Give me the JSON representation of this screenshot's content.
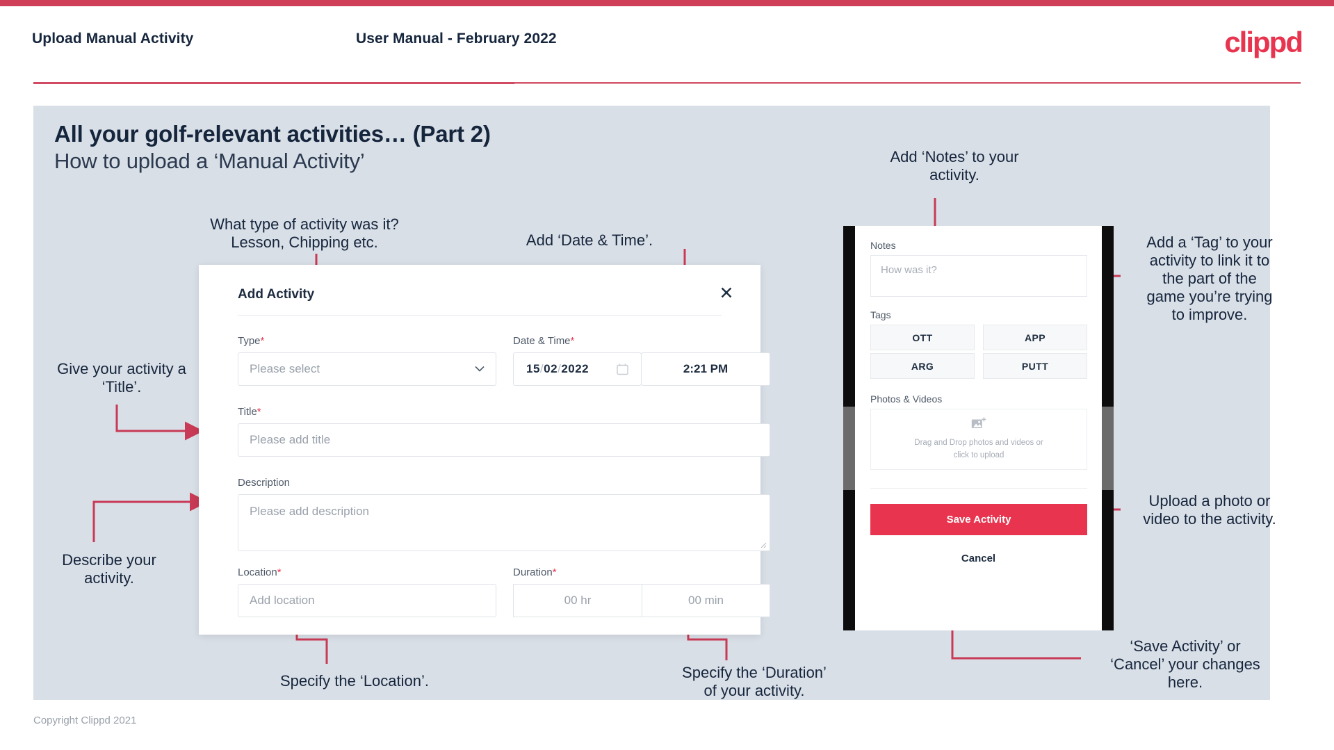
{
  "theme": {
    "brand_red": "#e8344e",
    "bar_red": "#cf4058",
    "arrow_red": "#c83a55",
    "slide_bg": "#d9dfe7",
    "ink": "#15253c"
  },
  "header": {
    "left_title": "Upload Manual Activity",
    "center_title": "User Manual - February 2022",
    "logo_text": "clippd"
  },
  "slide": {
    "title": "All your golf-relevant activities… (Part 2)",
    "subtitle": "How to upload a ‘Manual Activity’"
  },
  "annotations": {
    "type": "What type of activity was it?\nLesson, Chipping etc.",
    "type_line1": "What type of activity was it?",
    "type_line2": "Lesson, Chipping etc.",
    "datetime": "Add ‘Date & Time’.",
    "title": "Give your activity a\n‘Title’.",
    "title_line1": "Give your activity a",
    "title_line2": "‘Title’.",
    "description_line1": "Describe your",
    "description_line2": "activity.",
    "location": "Specify the ‘Location’.",
    "duration_line1": "Specify the ‘Duration’",
    "duration_line2": "of your activity.",
    "notes_line1": "Add ‘Notes’ to your",
    "notes_line2": "activity.",
    "tags_line1": "Add a ‘Tag’ to your",
    "tags_line2": "activity to link it to",
    "tags_line3": "the part of the",
    "tags_line4": "game you’re trying",
    "tags_line5": "to improve.",
    "upload_line1": "Upload a photo or",
    "upload_line2": "video to the activity.",
    "save_line1": "‘Save Activity’ or",
    "save_line2": "‘Cancel’ your changes",
    "save_line3": "here."
  },
  "dialog": {
    "title": "Add Activity",
    "close_icon": "close-icon",
    "fields": {
      "type": {
        "label": "Type",
        "required": "*",
        "placeholder": "Please select"
      },
      "datetime": {
        "label": "Date & Time",
        "required": "*",
        "day": "15",
        "month": "02",
        "year": "2022",
        "sep": "/",
        "time": "2:21 PM"
      },
      "title": {
        "label": "Title",
        "required": "*",
        "placeholder": "Please add title"
      },
      "description": {
        "label": "Description",
        "required": "",
        "placeholder": "Please add description"
      },
      "location": {
        "label": "Location",
        "required": "*",
        "placeholder": "Add location"
      },
      "duration": {
        "label": "Duration",
        "required": "*",
        "hours_placeholder": "00 hr",
        "minutes_placeholder": "00 min"
      }
    }
  },
  "phone": {
    "notes": {
      "label": "Notes",
      "placeholder": "How was it?"
    },
    "tags": {
      "label": "Tags",
      "items": [
        "OTT",
        "APP",
        "ARG",
        "PUTT"
      ]
    },
    "photos": {
      "label": "Photos & Videos",
      "dropzone_line1": "Drag and Drop photos and videos or",
      "dropzone_line2": "click to upload",
      "icon": "add-image-icon"
    },
    "save_label": "Save Activity",
    "cancel_label": "Cancel"
  },
  "footer": {
    "copyright": "Copyright Clippd 2021"
  }
}
